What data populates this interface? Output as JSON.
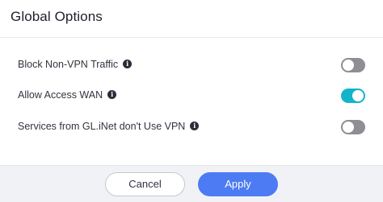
{
  "dialog": {
    "title": "Global Options"
  },
  "options": [
    {
      "label": "Block Non-VPN Traffic",
      "info_icon": "info-icon",
      "enabled": false
    },
    {
      "label": "Allow Access WAN",
      "info_icon": "info-icon",
      "enabled": true
    },
    {
      "label": "Services from GL.iNet don't Use VPN",
      "info_icon": "info-icon",
      "enabled": false
    }
  ],
  "footer": {
    "cancel_label": "Cancel",
    "apply_label": "Apply"
  },
  "colors": {
    "toggle_on": "#13b4c9",
    "toggle_off": "#8e8e93",
    "primary": "#4d7bf3"
  }
}
